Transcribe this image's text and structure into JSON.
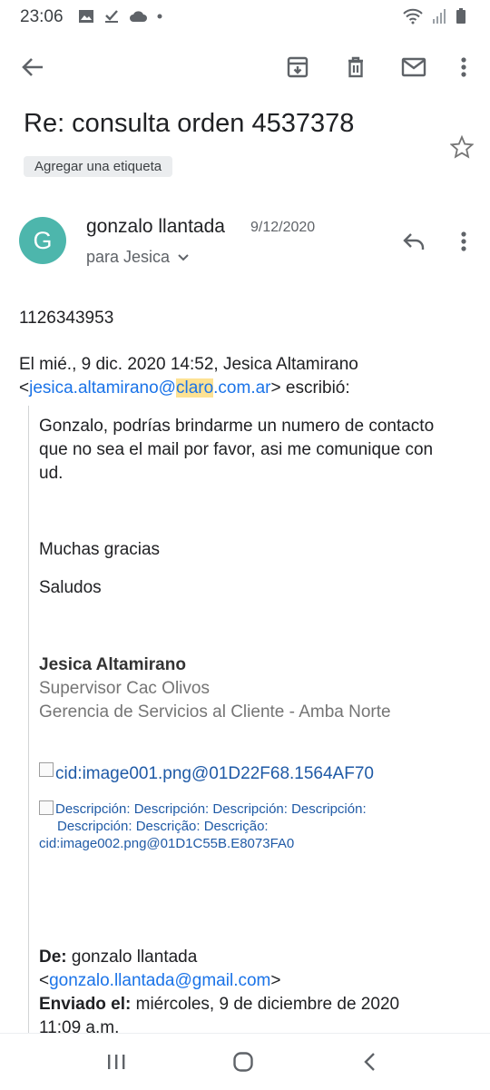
{
  "status_bar": {
    "time": "23:06",
    "left_icons": [
      "image-icon",
      "check-download-icon",
      "cloud-icon",
      "dot-icon"
    ],
    "right_icons": [
      "wifi-icon",
      "signal-icon",
      "battery-icon"
    ]
  },
  "toolbar": {
    "back": "back-arrow-icon",
    "actions": [
      "archive-icon",
      "delete-icon",
      "mark-unread-icon",
      "more-vert-icon"
    ]
  },
  "email": {
    "subject": "Re: consulta orden 4537378",
    "label_chip": "Agregar una etiqueta",
    "sender": {
      "initial": "G",
      "avatar_color": "#4db6ac",
      "name": "gonzalo llantada",
      "date": "9/12/2020",
      "recipient": "para Jesica"
    },
    "body": {
      "phone": "1126343953",
      "reply_header_line1": "El mié., 9 dic. 2020 14:52, Jesica Altamirano",
      "reply_lt": "<",
      "email_part1": "jesica.altamirano@",
      "email_highlight": "claro",
      "email_part2": ".com.ar",
      "reply_suffix": "> escribió:",
      "quote": {
        "paragraph": "Gonzalo, podrías brindarme un numero de contacto que no sea el mail por favor, asi me comunique con ud.",
        "thanks": "Muchas gracias",
        "greeting": "Saludos",
        "sig_name": "Jesica Altamirano",
        "sig_title": "Supervisor Cac Olivos",
        "sig_dept": "Gerencia de Servicios al Cliente - Amba Norte",
        "image1_alt": "cid:image001.png@01D22F68.1564AF70",
        "image2_alt_line1": "Descripción: Descripción: Descripción: Descripción:",
        "image2_alt_line2": "Descripción: Descrição: Descrição:",
        "image2_alt_line3": "cid:image002.png@01D1C55B.E8073FA0",
        "de_label": "De:",
        "de_value": " gonzalo llantada",
        "de_email_lt": "<",
        "de_email": "gonzalo.llantada@gmail.com",
        "de_email_gt": ">",
        "enviado_label": "Enviado el:",
        "enviado_value": " miércoles, 9 de diciembre de 2020",
        "enviado_time": "11:09 a.m."
      }
    }
  },
  "nav_bar": [
    "recent-apps-icon",
    "home-icon",
    "back-icon"
  ],
  "colors": {
    "link": "#1a73e8",
    "highlight": "#fde293",
    "chip_bg": "#ebedef",
    "signature_grey": "#757575"
  }
}
